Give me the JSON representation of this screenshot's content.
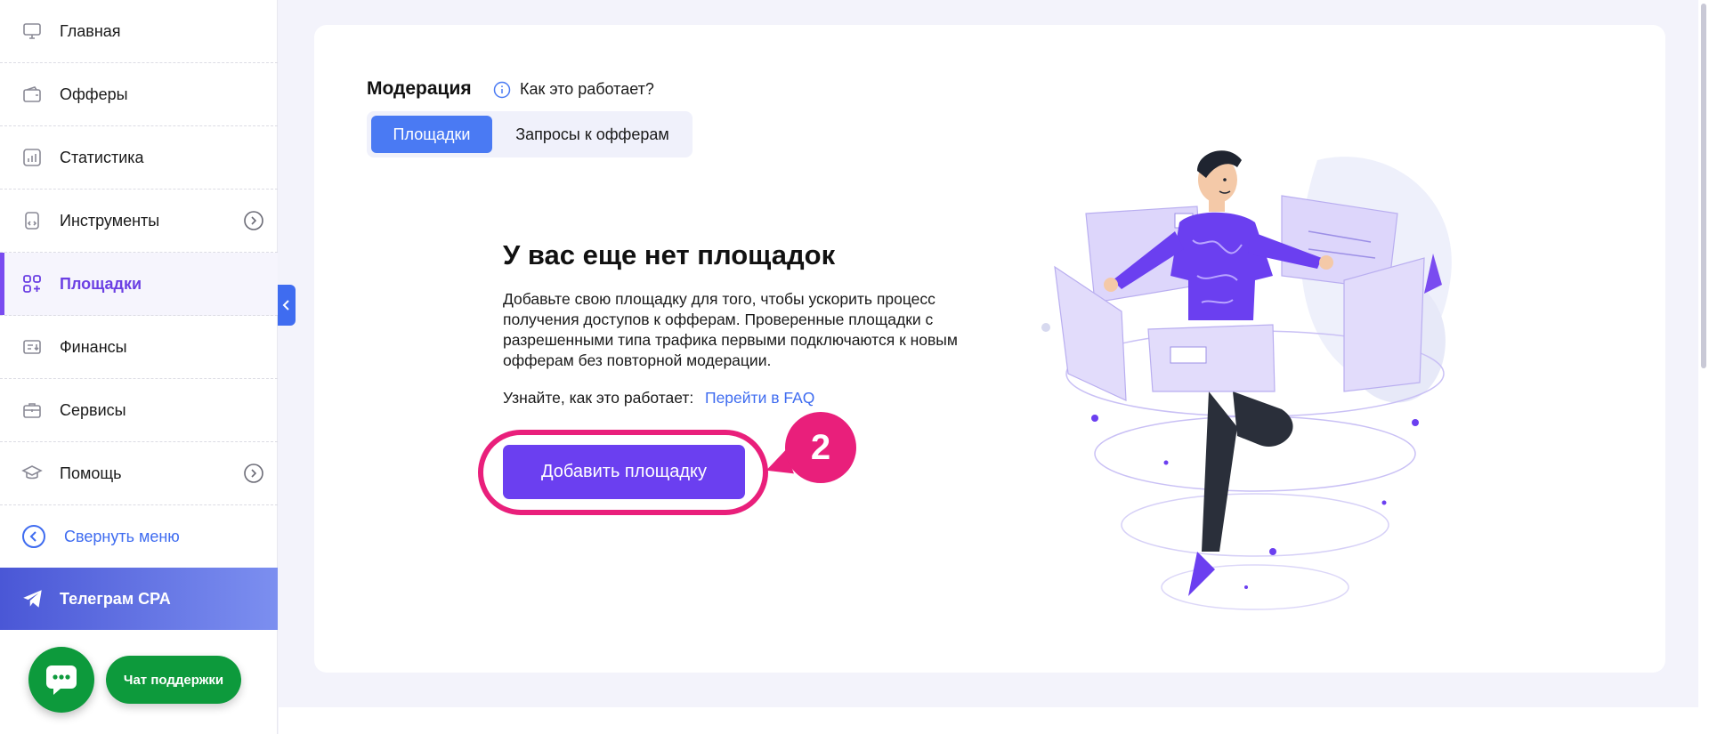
{
  "sidebar": {
    "items": [
      {
        "label": "Главная",
        "icon": "monitor-icon"
      },
      {
        "label": "Офферы",
        "icon": "wallet-icon"
      },
      {
        "label": "Статистика",
        "icon": "chart-icon"
      },
      {
        "label": "Инструменты",
        "icon": "tools-icon",
        "expandable": true
      },
      {
        "label": "Площадки",
        "icon": "grid-add-icon",
        "active": true
      },
      {
        "label": "Финансы",
        "icon": "finance-icon"
      },
      {
        "label": "Сервисы",
        "icon": "briefcase-icon"
      },
      {
        "label": "Помощь",
        "icon": "graduation-cap-icon",
        "expandable": true
      }
    ],
    "collapse_label": "Свернуть меню",
    "telegram_label": "Телеграм CPA"
  },
  "support": {
    "chat_label": "Чат поддержки"
  },
  "main": {
    "title": "Модерация",
    "how_it_works": "Как это работает?",
    "tabs": [
      {
        "label": "Площадки",
        "active": true
      },
      {
        "label": "Запросы к офферам",
        "active": false
      }
    ],
    "empty_state": {
      "heading": "У вас еще нет площадок",
      "description": "Добавьте свою площадку для того, чтобы ускорить процесс получения доступов к офферам. Проверенные площадки с разрешенными типа трафика первыми подключаются к новым офферам без повторной модерации.",
      "learn_text": "Узнайте, как это работает:",
      "faq_link": "Перейти в FAQ",
      "add_button": "Добавить площадку"
    },
    "step_badge": "2"
  },
  "colors": {
    "accent_purple": "#6b3ff0",
    "accent_blue": "#4a7af3",
    "highlight_pink": "#e91f7b",
    "support_green": "#0d9a3c"
  }
}
